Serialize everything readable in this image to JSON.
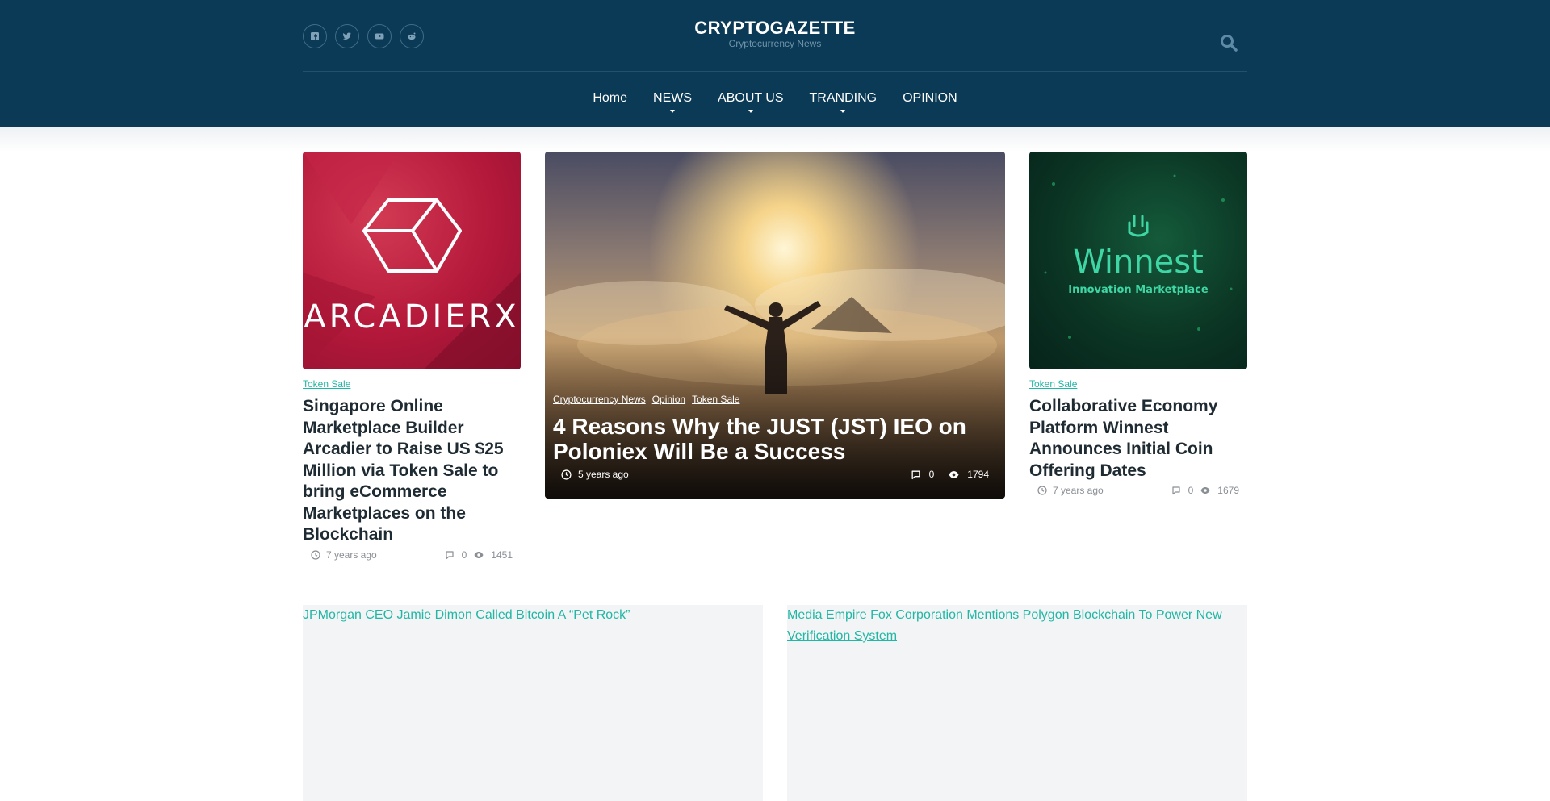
{
  "site": {
    "title": "CRYPTOGAZETTE",
    "tagline": "Cryptocurrency News"
  },
  "socials": [
    {
      "icon": "facebook-icon"
    },
    {
      "icon": "twitter-icon"
    },
    {
      "icon": "youtube-icon"
    },
    {
      "icon": "reddit-icon"
    }
  ],
  "nav": {
    "items": [
      {
        "label": "Home",
        "dropdown": false
      },
      {
        "label": "NEWS",
        "dropdown": true
      },
      {
        "label": "ABOUT US",
        "dropdown": true
      },
      {
        "label": "TRANDING",
        "dropdown": true
      },
      {
        "label": "OPINION",
        "dropdown": false
      }
    ]
  },
  "cards": [
    {
      "image_text": "ARCADIERX",
      "category": "Token Sale",
      "title": "Singapore Online Marketplace Builder Arcadier to Raise US $25 Million via Token Sale to bring eCommerce Marketplaces on the Blockchain",
      "time": "7 years ago",
      "comments": "0",
      "views": "1451"
    },
    {
      "image_text": "Winnest",
      "image_subtext": "Innovation Marketplace",
      "category": "Token Sale",
      "title": "Collaborative Economy Platform Winnest Announces Initial Coin Offering Dates",
      "time": "7 years ago",
      "comments": "0",
      "views": "1679"
    }
  ],
  "feature": {
    "categories": [
      "Cryptocurrency News",
      "Opinion",
      "Token Sale"
    ],
    "title": "4 Reasons Why the JUST (JST) IEO on Poloniex Will Be a Success",
    "time": "5 years ago",
    "comments": "0",
    "views": "1794"
  },
  "wide_cards": [
    {
      "alt": "JPMorgan CEO Jamie Dimon Called Bitcoin A “Pet Rock”"
    },
    {
      "alt": "Media Empire Fox Corporation Mentions Polygon Blockchain To Power New Verification System"
    }
  ],
  "colors": {
    "header_bg": "#0b3a57",
    "accent": "#22b7a5",
    "title_text": "#1f2b33"
  }
}
